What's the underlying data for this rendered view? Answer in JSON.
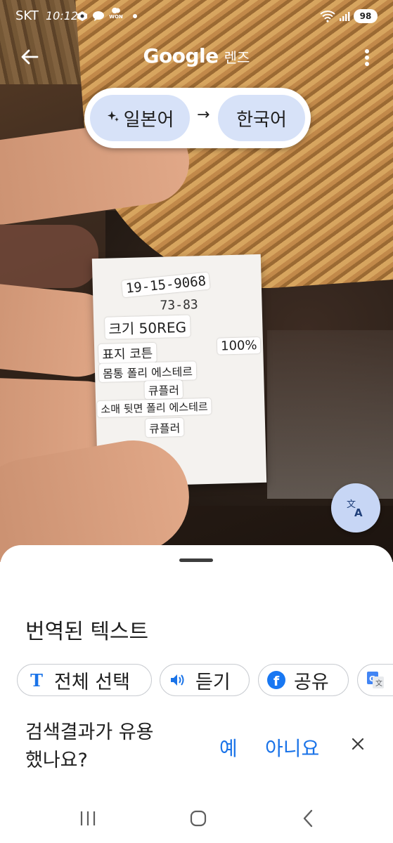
{
  "status_bar": {
    "carrier": "SKT",
    "time": "10:12",
    "battery": "98",
    "icons": [
      "app-notification-icon",
      "chat-bubble-icon",
      "won-app-icon",
      "dot-icon",
      "wifi-icon",
      "signal-icon",
      "battery-icon"
    ],
    "won_label": "WON"
  },
  "top_bar": {
    "logo": "Google",
    "product": "렌즈",
    "back_icon": "arrow-left-icon",
    "more_icon": "more-vert-icon"
  },
  "language": {
    "source": "일본어",
    "target": "한국어",
    "arrow": "→",
    "sparkle_icon": "sparkle-icon"
  },
  "tag_overlays": {
    "line1": "19-15-9068",
    "line2": "73-83",
    "size": "크기 50REG",
    "face": "표지 코튼",
    "percent": "100%",
    "body": "몸통 폴리 에스테르",
    "body2": "큐플러",
    "sleeve": "소매 뒷면 폴리 에스테르",
    "sleeve2": "큐플러"
  },
  "fab": {
    "icon": "translate-icon"
  },
  "sheet": {
    "title": "번역된 텍스트",
    "actions": {
      "select_all": "전체 선택",
      "listen": "듣기",
      "share": "공유"
    },
    "feedback": {
      "question": "검색결과가 유용했나요?",
      "yes": "예",
      "no": "아니요"
    }
  },
  "nav": {
    "recents_icon": "recents-icon",
    "home_icon": "home-icon",
    "back_icon": "back-icon"
  },
  "colors": {
    "accent": "#1a73e8",
    "pill": "#d7e2f8",
    "fab": "#c7d6f5"
  }
}
